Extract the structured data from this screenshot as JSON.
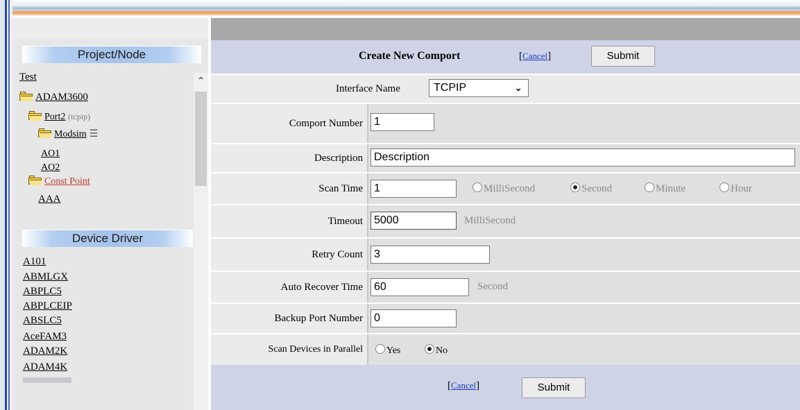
{
  "left_panel": {
    "project_header": "Project/Node",
    "tree": [
      {
        "label": "Test",
        "sub": "",
        "icon": ""
      },
      {
        "label": "ADAM3600",
        "sub": "",
        "icon": "folder-icon"
      },
      {
        "label": "Port2",
        "sub": "(tcpip)",
        "icon": "folder-icon"
      },
      {
        "label": "Modsim",
        "sub": "",
        "icon": "folder-icon"
      },
      {
        "label": "AO1",
        "sub": "",
        "icon": ""
      },
      {
        "label": "AO2",
        "sub": "",
        "icon": ""
      },
      {
        "label": "Const Point",
        "sub": "",
        "icon": "folder-icon"
      },
      {
        "label": "AAA",
        "sub": "",
        "icon": ""
      }
    ],
    "driver_header": "Device Driver",
    "drivers": [
      "A101",
      "ABMLGX",
      "ABPLC5",
      "ABPLCEIP",
      "ABSLC5",
      "AceFAM3",
      "ADAM2K",
      "ADAM4K"
    ]
  },
  "form": {
    "title": "Create New Comport",
    "cancel_label": "Cancel",
    "submit_label": "Submit",
    "interface_label": "Interface Name",
    "interface_value": "TCPIP",
    "comport_label": "Comport Number",
    "comport_value": "1",
    "description_label": "Description",
    "description_value": "Description",
    "scan_time_label": "Scan Time",
    "scan_time_value": "1",
    "scan_units": [
      "MilliSecond",
      "Second",
      "Minute",
      "Hour"
    ],
    "scan_unit_selected": "Second",
    "timeout_label": "Timeout",
    "timeout_value": "5000",
    "timeout_unit": "MilliSecond",
    "retry_label": "Retry Count",
    "retry_value": "3",
    "auto_recover_label": "Auto Recover Time",
    "auto_recover_value": "60",
    "auto_recover_unit": "Second",
    "backup_port_label": "Backup Port Number",
    "backup_port_value": "0",
    "parallel_label": "Scan Devices in Parallel",
    "parallel_yes": "Yes",
    "parallel_no": "No",
    "parallel_selected": "No"
  }
}
